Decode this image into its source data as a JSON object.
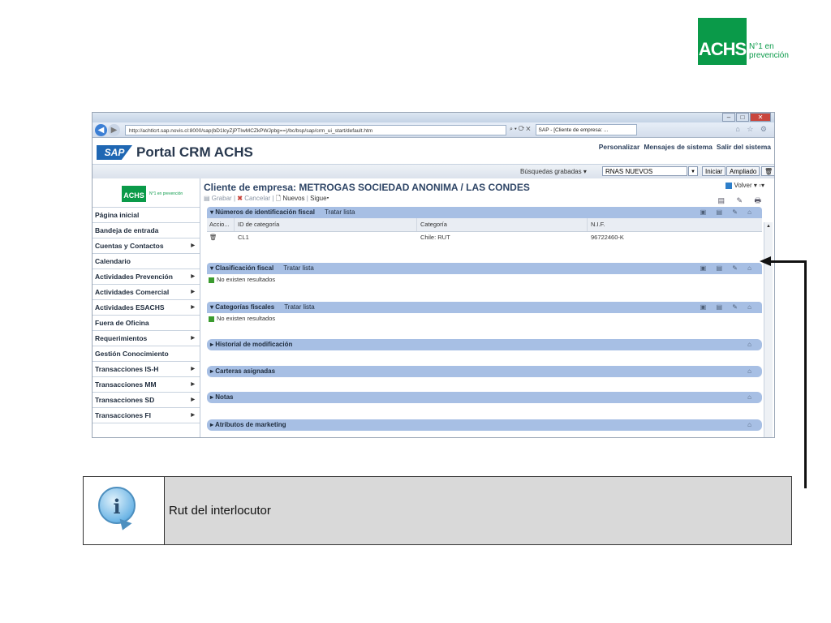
{
  "brand": {
    "logo_text": "ACHS",
    "tagline_line1": "N°1 en",
    "tagline_line2": "prevención",
    "green": "#0a9a49"
  },
  "browser": {
    "address": "http://achtlcrt.sap.novis.cl:8000/sap(bD1lcyZjPTIwMCZkPWJpbg==)/bc/bsp/sap/crm_ui_start/default.htm",
    "address_controls": "⌕ ▾ ⟳ ✕",
    "tab_label": "SAP - [Cliente de empresa: ...",
    "nav_icons": "⌂ ☆ ⚙"
  },
  "header": {
    "sap_logo": "SAP",
    "portal_title": "Portal CRM ACHS",
    "links": [
      "Personalizar",
      "Mensajes de sistema",
      "Salir del sistema"
    ]
  },
  "searchbar": {
    "label": "Búsquedas grabadas ▾",
    "selected": "RNAS NUEVOS",
    "iniciar": "Iniciar",
    "ampliado": "Ampliado"
  },
  "sidebar": {
    "logo_text": "ACHS",
    "logo_tag": "N°1 en prevención",
    "items": [
      {
        "label": "Página inicial",
        "arrow": ""
      },
      {
        "label": "Bandeja de entrada",
        "arrow": ""
      },
      {
        "label": "Cuentas y Contactos",
        "arrow": "▶"
      },
      {
        "label": "Calendario",
        "arrow": ""
      },
      {
        "label": "Actividades Prevención",
        "arrow": "▶"
      },
      {
        "label": "Actividades Comercial",
        "arrow": "▶"
      },
      {
        "label": "Actividades ESACHS",
        "arrow": "▶"
      },
      {
        "label": "Fuera de Oficina",
        "arrow": ""
      },
      {
        "label": "Requerimientos",
        "arrow": "▶"
      },
      {
        "label": "Gestión Conocimiento",
        "arrow": ""
      },
      {
        "label": "Transacciones IS-H",
        "arrow": "▶"
      },
      {
        "label": "Transacciones MM",
        "arrow": "▶"
      },
      {
        "label": "Transacciones SD",
        "arrow": "▶"
      },
      {
        "label": "Transacciones FI",
        "arrow": "▶"
      }
    ]
  },
  "main": {
    "title": "Cliente de empresa: METROGAS SOCIEDAD ANONIMA / LAS CONDES",
    "volver": "Volver ▾",
    "actions": {
      "grabar": "Grabar",
      "cancelar": "Cancelar",
      "nuevos": "Nuevos",
      "sigue": "Sigue▾"
    },
    "blocks": [
      {
        "title": "Números de identificación fiscal",
        "tratar": "Tratar lista",
        "columns": [
          "Accio...",
          "ID de categoría",
          "Categoría",
          "N.I.F."
        ],
        "rows": [
          [
            "",
            "CL1",
            "Chile: RUT",
            "96722460-K"
          ]
        ]
      },
      {
        "title": "Clasificación fiscal",
        "tratar": "Tratar lista",
        "empty": "No existen resultados"
      },
      {
        "title": "Categorías fiscales",
        "tratar": "Tratar lista",
        "empty": "No existen resultados"
      },
      {
        "title": "Historial de modificación"
      },
      {
        "title": "Carteras asignadas"
      },
      {
        "title": "Notas"
      },
      {
        "title": "Atributos de marketing"
      }
    ]
  },
  "note": {
    "text": "Rut  del interlocutor"
  }
}
